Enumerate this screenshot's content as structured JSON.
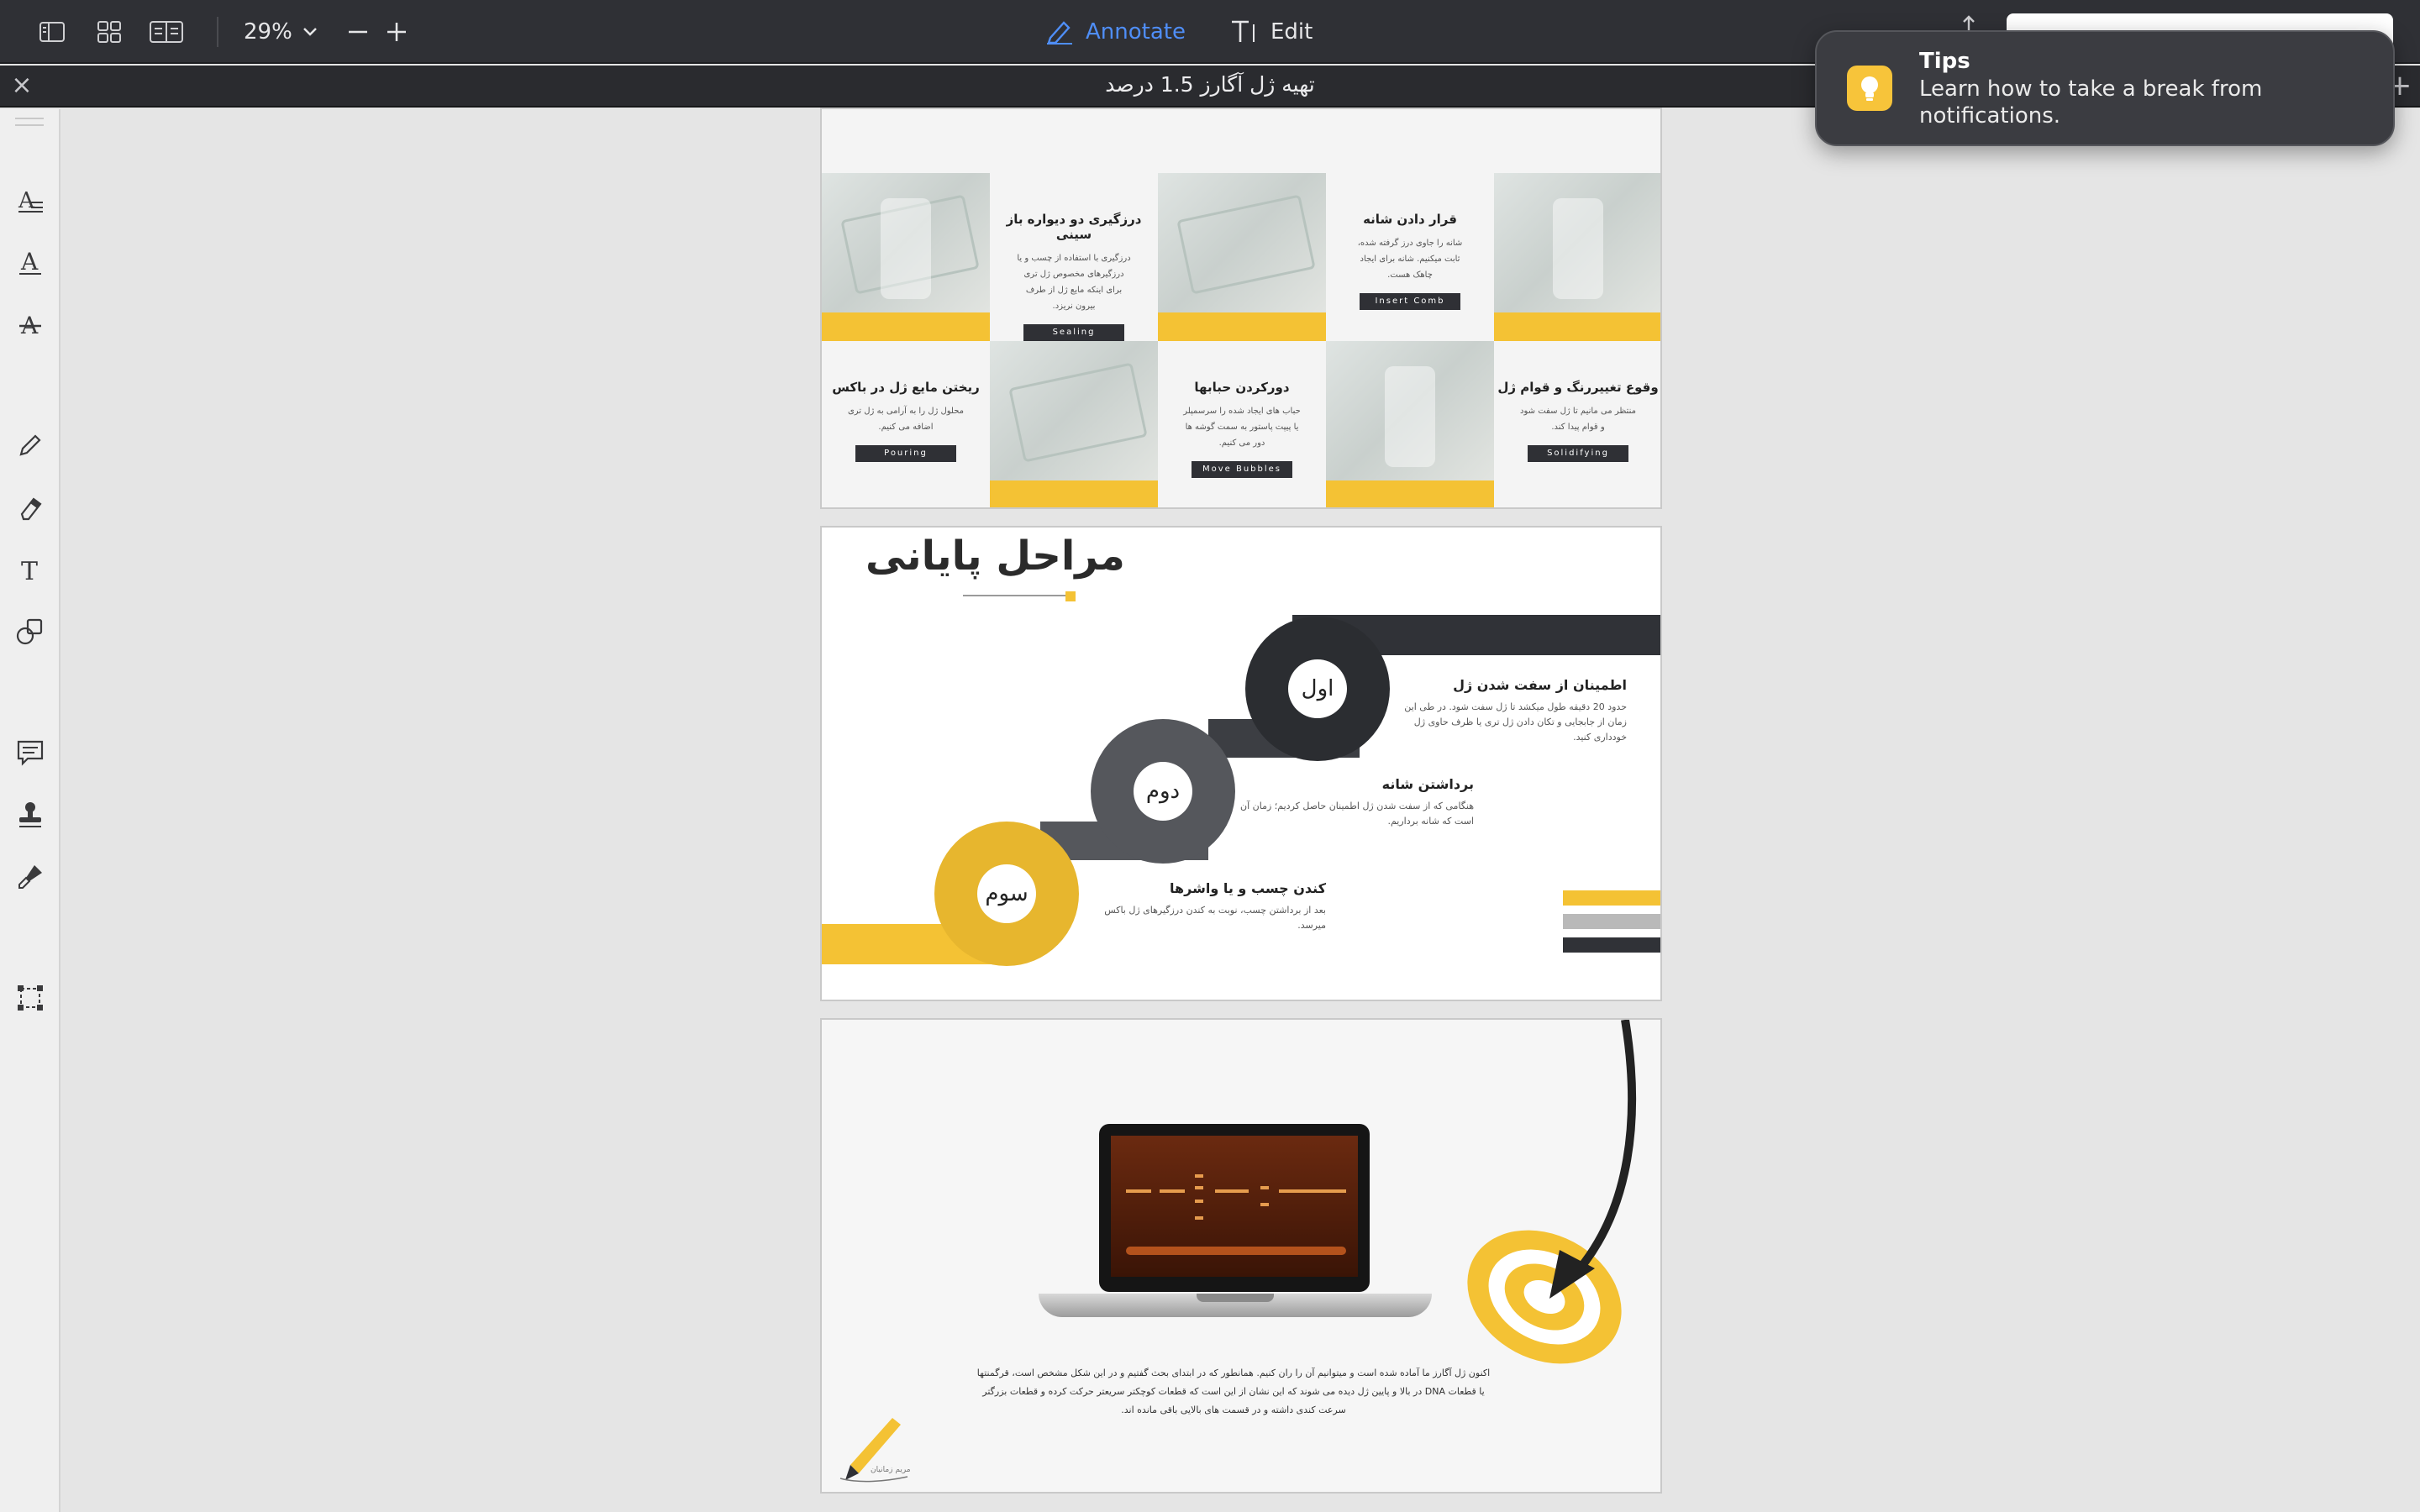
{
  "toolbar": {
    "zoom_label": "29%",
    "annotate_label": "Annotate",
    "edit_label": "Edit"
  },
  "tab": {
    "title": "تهیه ژل آگارز 1.5 درصد"
  },
  "page1": {
    "cells": [
      {
        "title": "درزگیری دو دیواره باز سینی",
        "body": "درزگیری با استفاده از چسب و یا درزگیرهای مخصوص ژل تری برای اینکه مایع ژل از طرف بیرون نریزد.",
        "tag": "Sealing"
      },
      {
        "title": "قرار دادن شانه",
        "body": "شانه را جاوی درز گرفته شده، ثابت میکنیم. شانه برای ایجاد چاهک هست.",
        "tag": "Insert Comb"
      },
      {
        "title": "ریختن مایع ژل در باکس",
        "body": "محلول ژل را به آرامی به ژل تری اضافه می کنیم.",
        "tag": "Pouring"
      },
      {
        "title": "دورکردن حبابها",
        "body": "حباب های ایجاد شده را سرسمپلر یا پیپت پاستور به سمت گوشه ها دور می کنیم.",
        "tag": "Move Bubbles"
      },
      {
        "title": "وقوع تغییررنگ و قوام ژل",
        "body": "منتظر می مانیم تا ژل سفت شود و قوام پیدا کند.",
        "tag": "Solidifying"
      }
    ]
  },
  "page2": {
    "title": "مراحل پایانی",
    "steps": [
      {
        "num": "اول",
        "title": "اطمینان از سفت شدن ژل",
        "body": "حدود 20 دقیقه طول میکشد تا ژل سفت شود. در طی این زمان از جابجایی و تکان دادن ژل تری یا ظرف حاوی ژل خودداری کنید."
      },
      {
        "num": "دوم",
        "title": "برداشتن شانه",
        "body": "هنگامی که از سفت شدن ژل اطمینان حاصل کردیم؛ زمان آن است که شانه برداریم."
      },
      {
        "num": "سوم",
        "title": "کندن چسب و یا واشرها",
        "body": "بعد از برداشتن چسب، نوبت به کندن درزگیرهای ژل باکس میرسد."
      }
    ]
  },
  "page3": {
    "text": "اکنون ژل آگارز ما آماده شده است و میتوانیم آن را ران کنیم. همانطور که در ابتدای بحث گفتیم و در این شکل مشخص است، قرگمنتها یا قطعات DNA در بالا و پایین ژل دیده می شوند که این نشان از این است که قطعات کوچکتر سریعتر حرکت کرده و قطعات بزرگتر سرعت کندی داشته و در قسمت های بالایی باقی مانده اند.",
    "signature": "مریم زمانیان"
  },
  "notification": {
    "title": "Tips",
    "body": "Learn how to take a break from notifications."
  },
  "colors": {
    "accent": "#4f8ef7",
    "yellow": "#f4c234",
    "dark": "#2f3035"
  }
}
